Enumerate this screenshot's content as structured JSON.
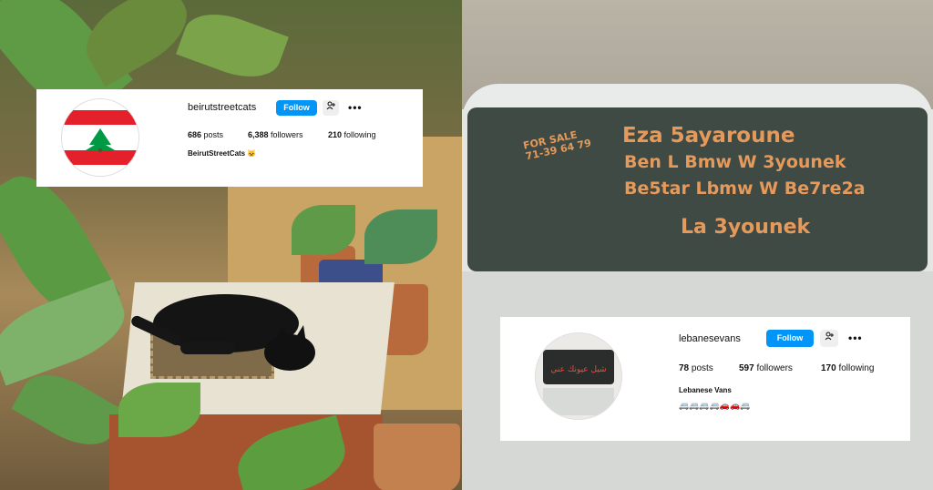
{
  "profiles": [
    {
      "username": "beirutstreetcats",
      "follow_label": "Follow",
      "add_icon": "person-add-icon",
      "more_label": "•••",
      "posts_count": "686",
      "posts_label": "posts",
      "followers_count": "6,388",
      "followers_label": "followers",
      "following_count": "210",
      "following_label": "following",
      "bio_name": "BeirutStreetCats 🐱",
      "avatar": "lebanon-flag"
    },
    {
      "username": "lebanesevans",
      "follow_label": "Follow",
      "add_icon": "person-add-icon",
      "more_label": "•••",
      "posts_count": "78",
      "posts_label": "posts",
      "followers_count": "597",
      "followers_label": "followers",
      "following_count": "170",
      "following_label": "following",
      "bio_name": "Lebanese Vans",
      "bio_emojis": "🚐🚐🚐🚐🚗🚗🚐",
      "avatar": "van-photo"
    }
  ],
  "van_window_text": {
    "for_sale": "FOR SALE",
    "phone": "71-39 64 79",
    "line1": "Eza 5ayaroune",
    "line2": "Ben L Bmw W 3younek",
    "line3": "Be5tar Lbmw W Be7re2a",
    "line4": "La 3younek"
  },
  "colors": {
    "follow_blue": "#0095f6",
    "window_text": "#e59a5b",
    "flag_red": "#e4202b",
    "cedar_green": "#009a44"
  }
}
